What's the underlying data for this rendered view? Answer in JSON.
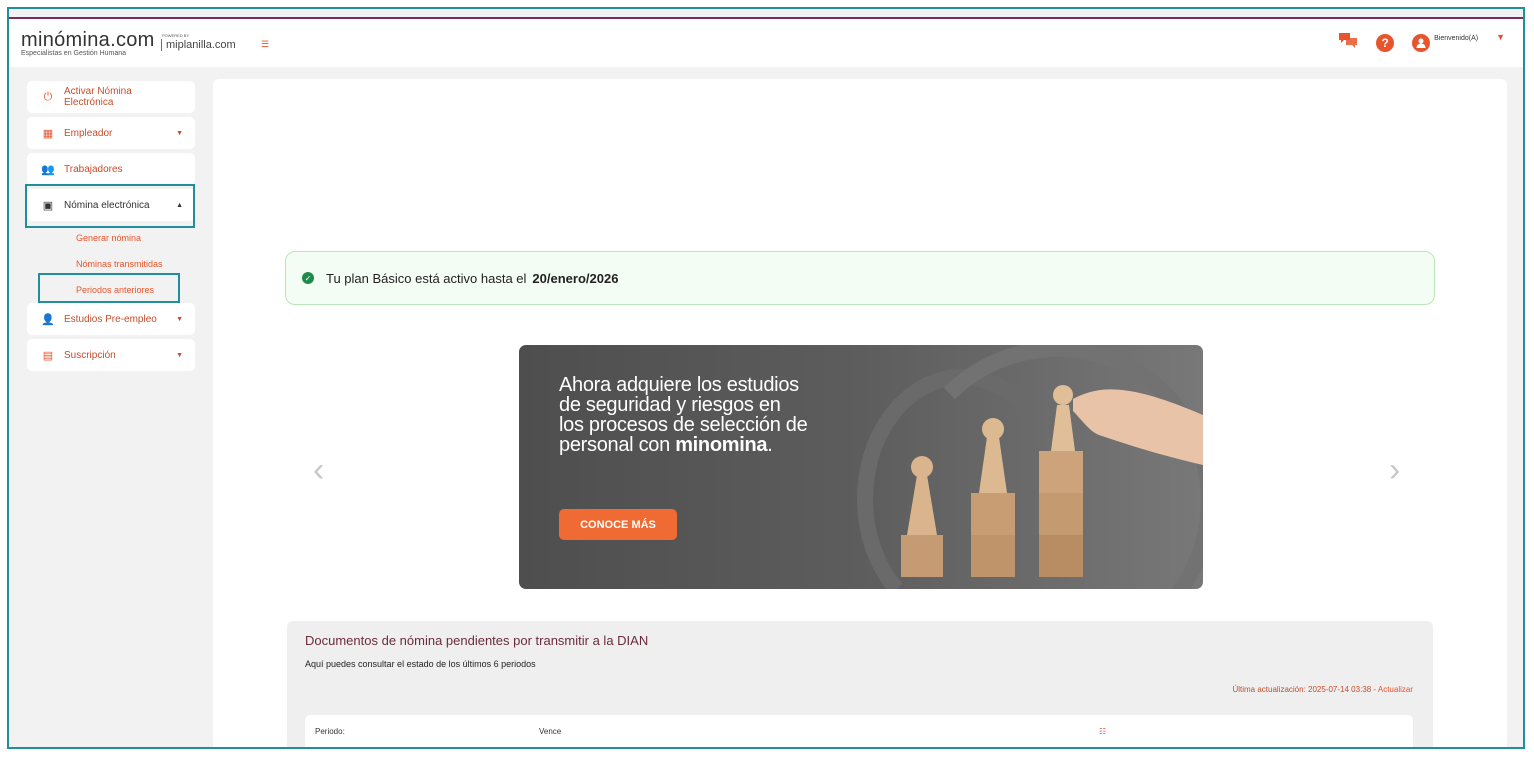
{
  "brand": {
    "logo": "minómina.com",
    "tagline": "Especialistas en Gestión Humana",
    "powered_by": "POWERED BY",
    "partner": "miplanilla.com"
  },
  "header": {
    "welcome": "Bienvenido(A)",
    "icons": [
      "chat-icon",
      "help-icon",
      "user-icon",
      "caret-down-icon"
    ]
  },
  "sidebar": {
    "items": [
      {
        "label": "Activar Nómina Electrónica",
        "icon": "power-icon"
      },
      {
        "label": "Empleador",
        "icon": "building-icon"
      },
      {
        "label": "Trabajadores",
        "icon": "users-icon"
      },
      {
        "label": "Nómina electrónica",
        "icon": "document-icon"
      },
      {
        "label": "Estudios Pre-empleo",
        "icon": "user-add-icon"
      },
      {
        "label": "Suscripción",
        "icon": "card-icon"
      }
    ],
    "submenu": [
      {
        "label": "Generar nómina"
      },
      {
        "label": "Nóminas transmitidas"
      },
      {
        "label": "Periodos anteriores"
      }
    ]
  },
  "plan": {
    "text": "Tu plan Básico está activo hasta el",
    "date": "20/enero/2026"
  },
  "banner": {
    "line1": "Ahora adquiere los estudios",
    "line2": "de seguridad y riesgos en",
    "line3": "los procesos de selección de",
    "line4_prefix": "personal con ",
    "line4_brand": "minomina",
    "line4_suffix": ".",
    "button": "CONOCE MÁS"
  },
  "documents": {
    "title": "Documentos de nómina pendientes por transmitir a la DIAN",
    "subtitle": "Aquí puedes consultar el estado de los últimos 6 periodos",
    "update_label": "Última actualización: 2025-07-14 03:38",
    "separator": "-",
    "update_link": "Actualizar",
    "columns": [
      "Periodo:",
      "Vence",
      "☷"
    ]
  },
  "colors": {
    "accent": "#e8552d",
    "highlight": "#1f8fa0",
    "success": "#1f8b4a"
  }
}
